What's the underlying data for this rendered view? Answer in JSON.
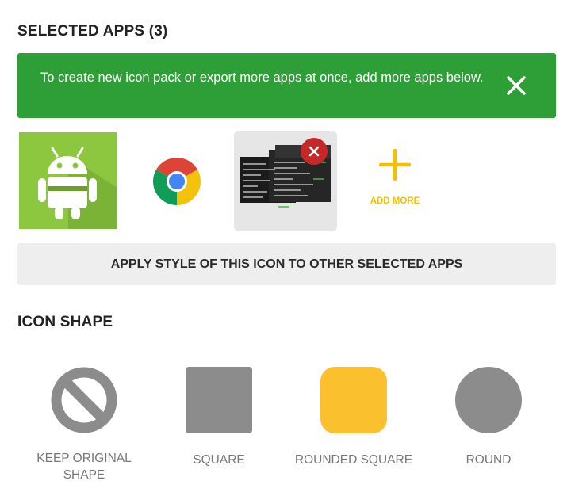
{
  "selected_apps": {
    "title": "SELECTED APPS (3)",
    "banner_text": "To create new icon pack or export more apps at once, add more apps below.",
    "add_more_label": "ADD MORE",
    "apply_button_label": "APPLY STYLE OF THIS ICON TO OTHER SELECTED APPS",
    "apps": [
      {
        "icon": "android-robot-icon"
      },
      {
        "icon": "chrome-icon"
      },
      {
        "icon": "terminal-screenshot-icon"
      }
    ]
  },
  "icon_shape": {
    "title": "ICON SHAPE",
    "options": [
      {
        "label_line1": "KEEP ORIGINAL",
        "label_line2": "SHAPE",
        "icon": "no-symbol-icon",
        "selected": false
      },
      {
        "label": "SQUARE",
        "icon": "square-icon",
        "selected": false
      },
      {
        "label": "ROUNDED SQUARE",
        "icon": "rounded-square-icon",
        "selected": true
      },
      {
        "label": "ROUND",
        "icon": "circle-icon",
        "selected": false
      }
    ]
  },
  "colors": {
    "banner": "#2e9e36",
    "accent": "#f5c000",
    "selected_shape": "#fbc02d",
    "shape_gray": "#8c8c8c",
    "remove_badge": "#c62828"
  }
}
